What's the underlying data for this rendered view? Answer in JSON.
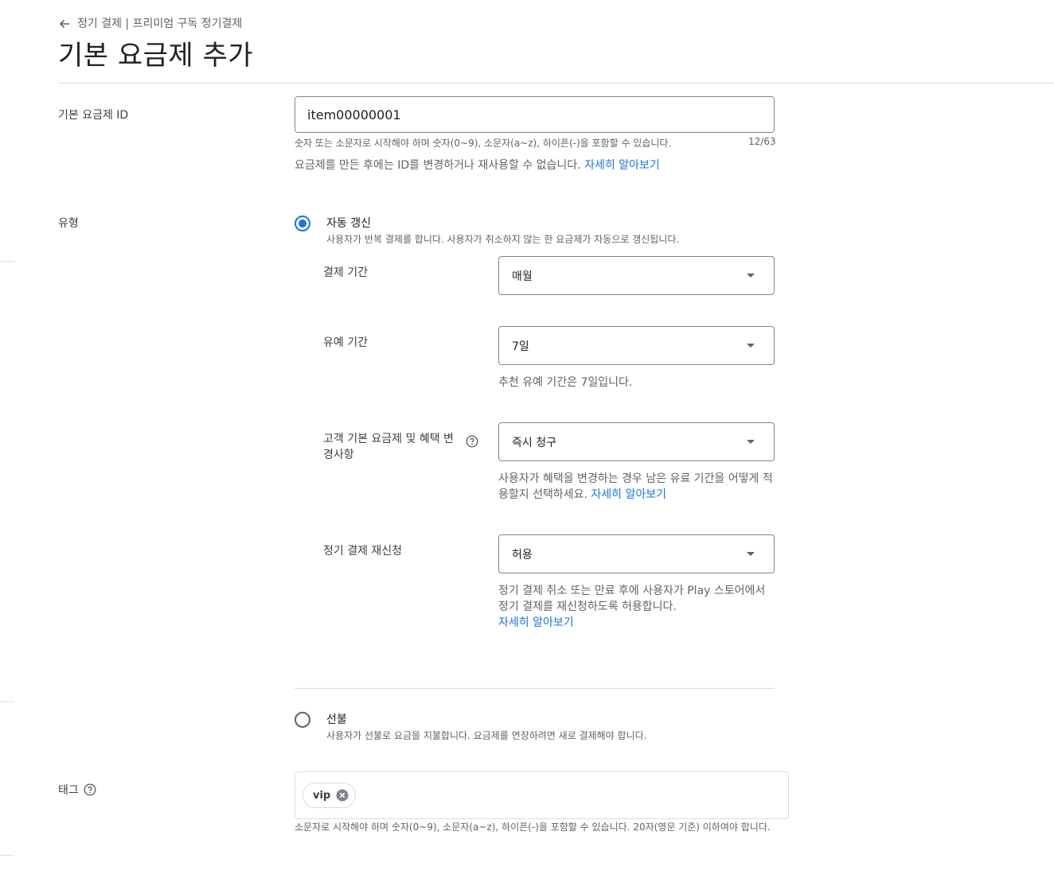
{
  "breadcrumb": {
    "text": "정기 결제 | 프리미엄 구독 정기결제"
  },
  "page": {
    "title": "기본 요금제 추가"
  },
  "base_plan_id": {
    "label": "기본 요금제 ID",
    "value": "item00000001",
    "helper": "숫자 또는 소문자로 시작해야 하며 숫자(0~9), 소문자(a~z), 하이픈(-)을 포함할 수 있습니다.",
    "counter": "12/63",
    "note": "요금제를 만든 후에는 ID를 변경하거나 재사용할 수 없습니다.",
    "learn_more": "자세히 알아보기"
  },
  "type": {
    "label": "유형",
    "auto_renew": {
      "title": "자동 갱신",
      "description": "사용자가 반복 결제를 합니다. 사용자가 취소하지 않는 한 요금제가 자동으로 갱신됩니다.",
      "selected": true,
      "billing_period": {
        "label": "결제 기간",
        "value": "매월"
      },
      "grace_period": {
        "label": "유예 기간",
        "value": "7일",
        "helper": "추천 유예 기간은 7일입니다."
      },
      "plan_change": {
        "label": "고객 기본 요금제 및 혜택 변경사항",
        "value": "즉시 청구",
        "helper": "사용자가 혜택을 변경하는 경우 남은 유료 기간을 어떻게 적용할지 선택하세요.",
        "learn_more": "자세히 알아보기"
      },
      "resubscribe": {
        "label": "정기 결제 재신청",
        "value": "허용",
        "helper": "정기 결제 취소 또는 만료 후에 사용자가 Play 스토어에서 정기 결제를 재신청하도록 허용합니다.",
        "learn_more": "자세히 알아보기"
      }
    },
    "prepaid": {
      "title": "선불",
      "description": "사용자가 선불로 요금을 지불합니다. 요금제를 연장하려면 새로 결제해야 합니다.",
      "selected": false
    }
  },
  "tags": {
    "label": "태그",
    "items": [
      "vip"
    ],
    "helper": "소문자로 시작해야 하며 숫자(0~9), 소문자(a~z), 하이픈(-)을 포함할 수 있습니다. 20자(영문 기준) 이하여야 합니다."
  },
  "colors": {
    "accent": "#1a73e8",
    "border": "#80868b",
    "divider": "#dadce0"
  }
}
